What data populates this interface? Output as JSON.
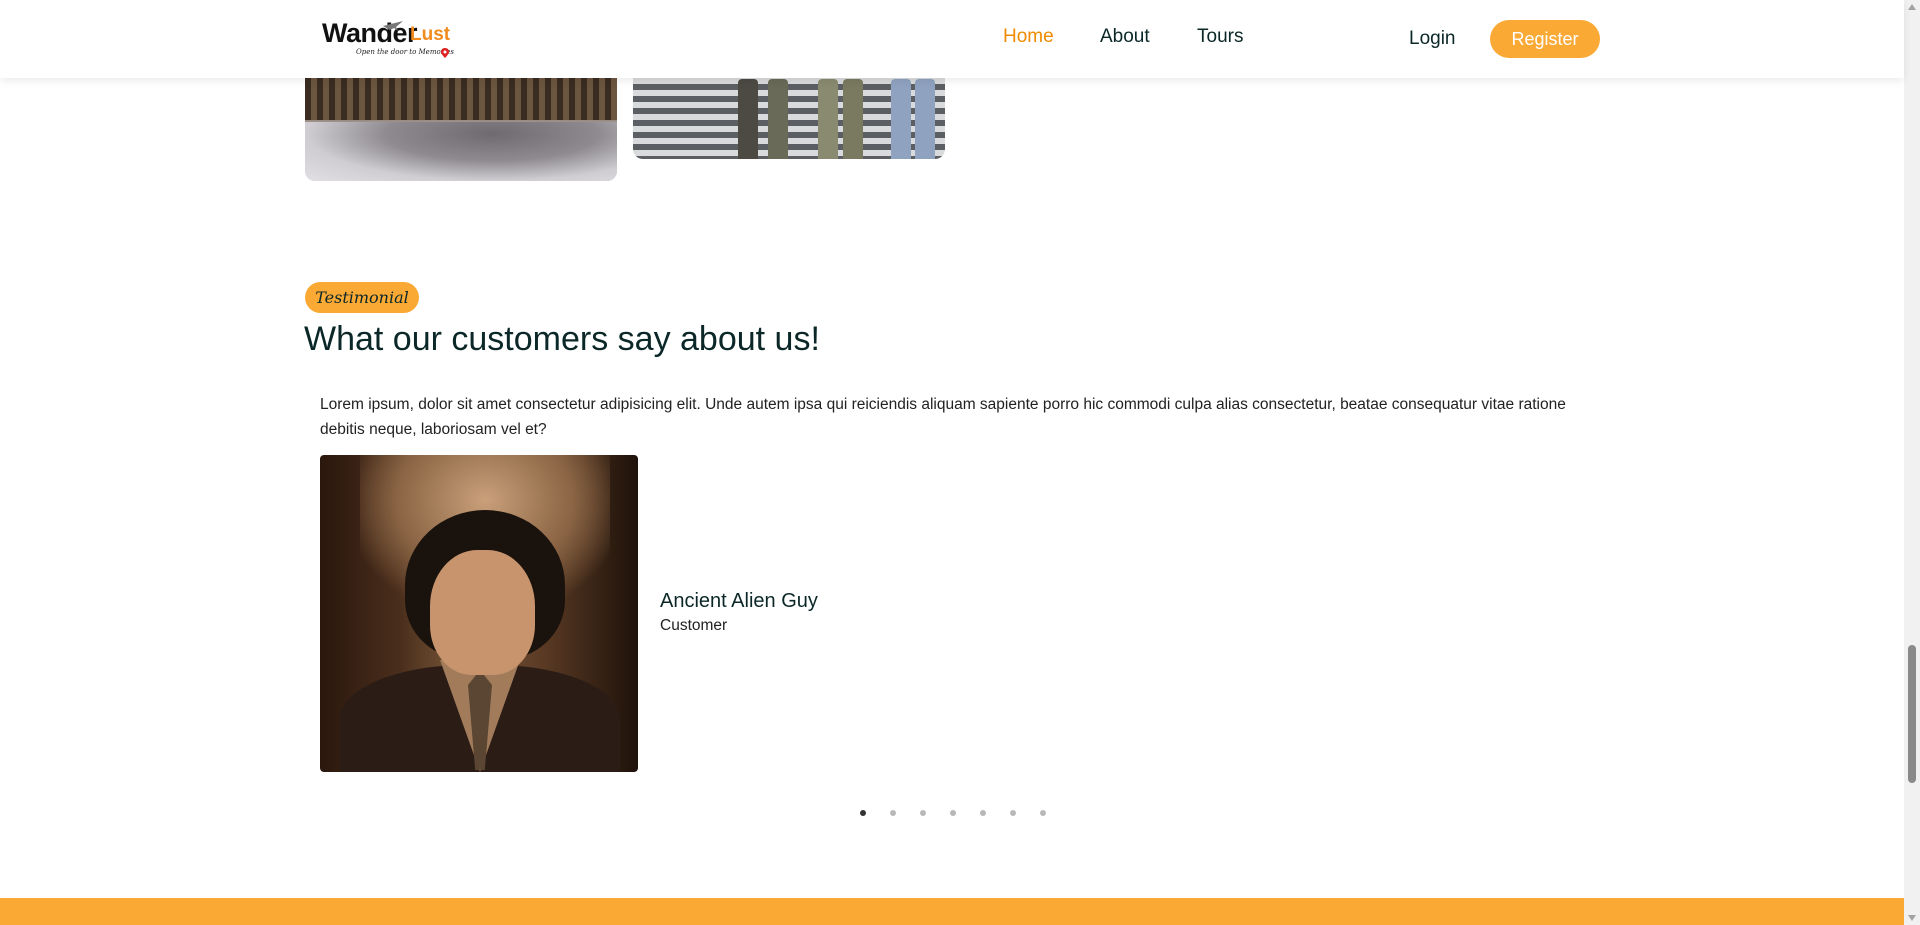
{
  "header": {
    "logo": {
      "word1": "Wander",
      "word2": "Lust",
      "tagline": "Open the door to Memories"
    },
    "nav": [
      {
        "label": "Home",
        "active": true
      },
      {
        "label": "About",
        "active": false
      },
      {
        "label": "Tours",
        "active": false
      }
    ],
    "login_label": "Login",
    "register_label": "Register"
  },
  "testimonial": {
    "badge": "Testimonial",
    "title": "What our customers say about us!",
    "quote": "Lorem ipsum, dolor sit amet consectetur adipisicing elit. Unde autem ipsa qui reiciendis aliquam sapiente porro hic commodi culpa alias consectetur, beatae consequatur vitae ratione debitis neque, laboriosam vel et?",
    "customer": {
      "name": "Ancient Alien Guy",
      "role": "Customer"
    },
    "slide_count": 7,
    "active_slide": 1
  },
  "colors": {
    "accent": "#faa935",
    "active_nav": "#f08a00",
    "heading": "#0b2727"
  },
  "icons": {
    "logo_plane": "plane-icon",
    "logo_pin": "location-pin-icon"
  }
}
